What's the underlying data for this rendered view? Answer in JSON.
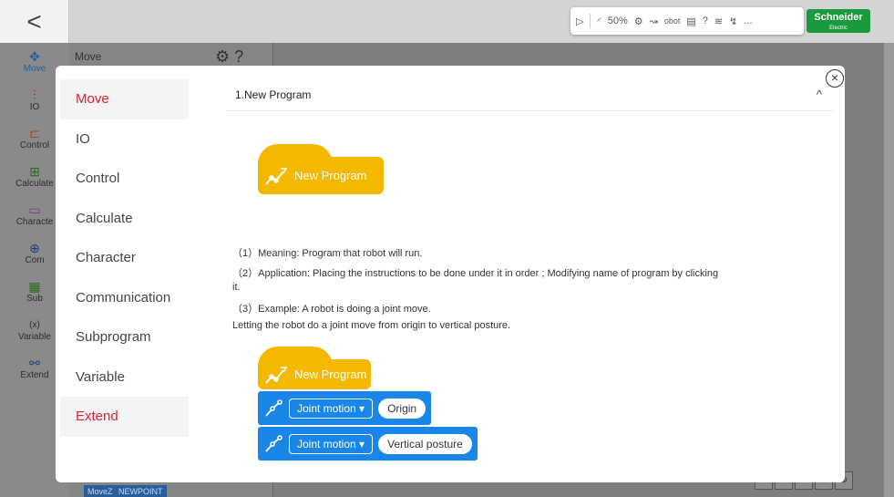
{
  "app": {
    "back_label": "<",
    "toolbar": {
      "speed": "50%",
      "robot_label": "obot",
      "help": "?",
      "more": "..."
    },
    "brand": {
      "name": "Schneider",
      "sub": "Electric",
      "color": "#1a9a3c"
    },
    "side_nav": [
      {
        "label": "Move",
        "icon": "move-icon",
        "glyph": "✥"
      },
      {
        "label": "IO",
        "icon": "io-icon",
        "glyph": "⫶"
      },
      {
        "label": "Control",
        "icon": "control-icon",
        "glyph": "⊏"
      },
      {
        "label": "Calculate",
        "icon": "calculate-icon",
        "glyph": "⊞"
      },
      {
        "label": "Characte",
        "icon": "character-icon",
        "glyph": "▭"
      },
      {
        "label": "Com",
        "icon": "communication-icon",
        "glyph": "⊕"
      },
      {
        "label": "Sub",
        "icon": "subprogram-icon",
        "glyph": "▦"
      },
      {
        "label": "Variable",
        "icon": "variable-icon",
        "glyph": "(x)"
      },
      {
        "label": "Extend",
        "icon": "extend-icon",
        "glyph": "⚯"
      }
    ],
    "panel_title": "Move",
    "bg_block": {
      "tag": "MoveZ",
      "name": "NEWPOINT"
    }
  },
  "modal": {
    "close_label": "×",
    "menu": [
      {
        "label": "Move"
      },
      {
        "label": "IO"
      },
      {
        "label": "Control"
      },
      {
        "label": "Calculate"
      },
      {
        "label": "Character"
      },
      {
        "label": "Communication"
      },
      {
        "label": "Subprogram"
      },
      {
        "label": "Variable"
      },
      {
        "label": "Extend"
      }
    ],
    "section_title": "1.New Program",
    "collapse_glyph": "^",
    "hat_block_label": "New Program",
    "desc": [
      "（1）Meaning: Program that robot will run.",
      "（2）Application: Placing the instructions to be done under it in order ; Modifying name of program by clicking",
      "it.",
      "（3）Example: A robot is doing a joint move.",
      "Letting the robot do a joint move from origin to vertical posture."
    ],
    "example": {
      "hat_label": "New Program",
      "blocks": [
        {
          "select": "Joint motion",
          "target": "Origin"
        },
        {
          "select": "Joint motion",
          "target": "Vertical posture"
        }
      ]
    },
    "accent_color": "#d9232e",
    "hat_color": "#f5b800",
    "block_color": "#1a87e8"
  }
}
